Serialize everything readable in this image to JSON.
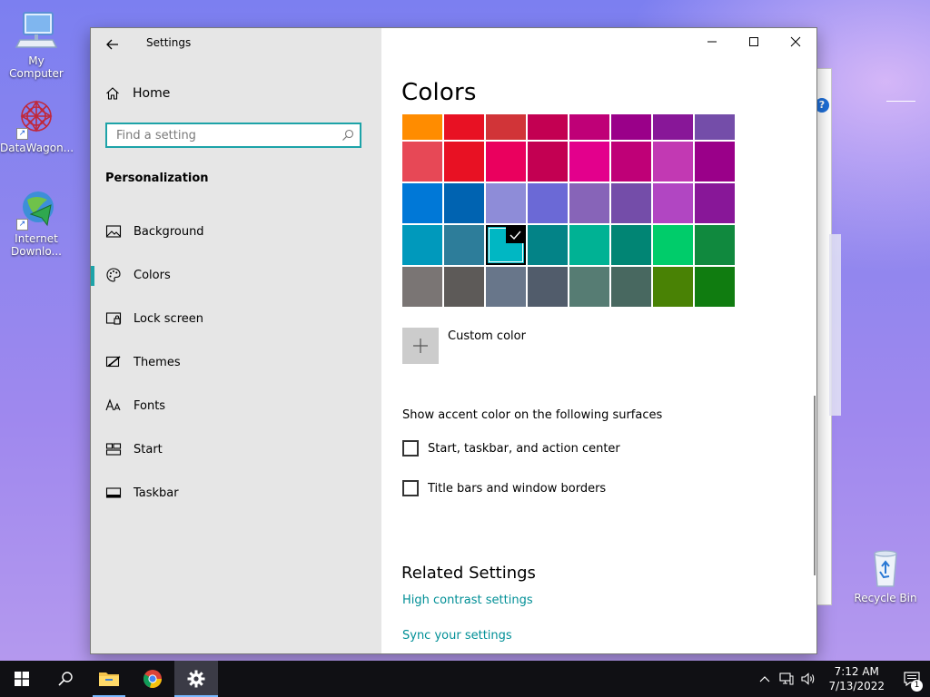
{
  "desktop": {
    "icons": [
      {
        "label": "My Computer",
        "icon": "computer-icon"
      },
      {
        "label": "DataWagon...",
        "icon": "datawagon-icon"
      },
      {
        "label": "Internet Downlo...",
        "icon": "internet-download-manager-icon"
      },
      {
        "label": "Recycle Bin",
        "icon": "recycle-bin-icon"
      }
    ]
  },
  "window": {
    "title": "Settings",
    "controls": {
      "minimize": "minimize-icon",
      "maximize": "maximize-icon",
      "close": "close-icon"
    }
  },
  "nav": {
    "home_label": "Home",
    "search_placeholder": "Find a setting",
    "search_value": "",
    "section_title": "Personalization",
    "items": [
      {
        "label": "Background",
        "icon": "picture-icon",
        "selected": false
      },
      {
        "label": "Colors",
        "icon": "palette-icon",
        "selected": true
      },
      {
        "label": "Lock screen",
        "icon": "lock-screen-icon",
        "selected": false
      },
      {
        "label": "Themes",
        "icon": "brush-icon",
        "selected": false
      },
      {
        "label": "Fonts",
        "icon": "font-icon",
        "selected": false
      },
      {
        "label": "Start",
        "icon": "start-layout-icon",
        "selected": false
      },
      {
        "label": "Taskbar",
        "icon": "taskbar-icon",
        "selected": false
      }
    ]
  },
  "main": {
    "page_title": "Colors",
    "swatch_rows": [
      [
        "#ff8c00",
        "#e81123",
        "#d13438",
        "#c30052",
        "#bf0077",
        "#9a0089",
        "#881798",
        "#744da9"
      ],
      [
        "#e74856",
        "#e81123",
        "#ea005e",
        "#c30052",
        "#e3008c",
        "#bf0077",
        "#c239b3",
        "#9a0089"
      ],
      [
        "#0078d7",
        "#0063b1",
        "#8e8cd8",
        "#6b69d6",
        "#8764b8",
        "#744da9",
        "#b146c2",
        "#881798"
      ],
      [
        "#0099bc",
        "#2d7d9a",
        "#00b7c3",
        "#038387",
        "#00b294",
        "#018574",
        "#00cc6a",
        "#10893e"
      ],
      [
        "#7a7574",
        "#5d5a58",
        "#68768a",
        "#515c6b",
        "#567c73",
        "#486860",
        "#498205",
        "#107c10"
      ],
      [
        "#767676",
        "#4c4a48",
        "#69797e",
        "#4a5459",
        "#647c64",
        "#525e54",
        "#847545",
        "#7e735f"
      ]
    ],
    "selected_color": "#00b7c3",
    "custom_color_label": "Custom color",
    "accent_surfaces_label": "Show accent color on the following surfaces",
    "checkboxes": [
      {
        "label": "Start, taskbar, and action center",
        "checked": false
      },
      {
        "label": "Title bars and window borders",
        "checked": false
      }
    ],
    "related_title": "Related Settings",
    "links": [
      "High contrast settings",
      "Sync your settings"
    ]
  },
  "taskbar": {
    "apps": [
      "start-icon",
      "search-icon",
      "file-explorer-icon",
      "chrome-icon",
      "settings-gear-icon"
    ],
    "time": "7:12 AM",
    "date": "7/13/2022",
    "notification_count": "1",
    "tray": [
      "chevron-up-icon",
      "network-icon",
      "volume-icon"
    ]
  },
  "colors": {
    "accent": "#1da3a8",
    "link": "#008f96",
    "nav_bg": "#e6e6e6",
    "taskbar_bg": "#101014"
  }
}
